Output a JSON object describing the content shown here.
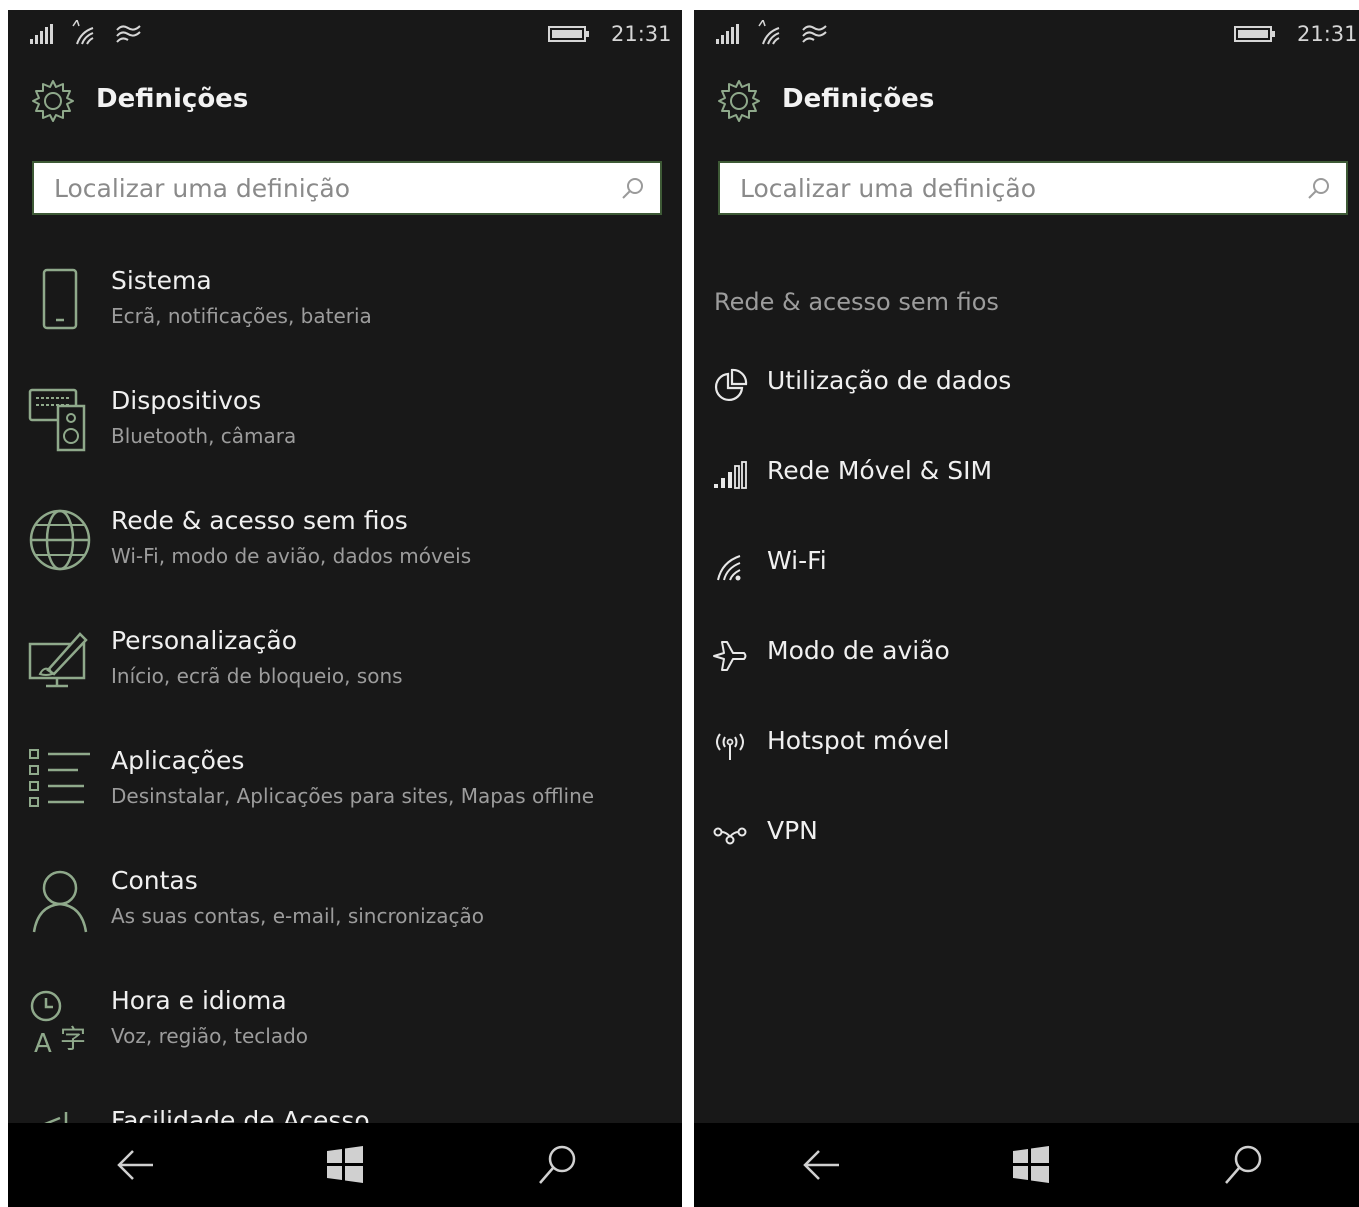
{
  "colors": {
    "background": "#181818",
    "accent": "#3e5a36",
    "icon_green": "#8fa98b",
    "text_primary": "#f0f0f0",
    "text_secondary": "#9c9c9c",
    "navbar": "#000000"
  },
  "status_bar": {
    "time": "21:31",
    "icons": [
      "signal-icon",
      "wifi-icon",
      "data-sense-icon",
      "battery-icon"
    ]
  },
  "left_screen": {
    "header": {
      "title": "Definições",
      "icon": "gear-icon"
    },
    "search": {
      "placeholder": "Localizar uma definição"
    },
    "categories": [
      {
        "title": "Sistema",
        "subtitle": "Ecrã, notificações, bateria",
        "icon": "phone-icon"
      },
      {
        "title": "Dispositivos",
        "subtitle": "Bluetooth, câmara",
        "icon": "devices-icon"
      },
      {
        "title": "Rede & acesso sem fios",
        "subtitle": "Wi-Fi, modo de avião, dados móveis",
        "icon": "globe-icon"
      },
      {
        "title": "Personalização",
        "subtitle": "Início, ecrã de bloqueio, sons",
        "icon": "paintbrush-icon"
      },
      {
        "title": "Aplicações",
        "subtitle": "Desinstalar, Aplicações para sites, Mapas offline",
        "icon": "apps-list-icon"
      },
      {
        "title": "Contas",
        "subtitle": "As suas contas, e-mail, sincronização",
        "icon": "person-icon"
      },
      {
        "title": "Hora e idioma",
        "subtitle": "Voz, região, teclado",
        "icon": "time-language-icon"
      },
      {
        "title": "Facilidade de Acesso",
        "subtitle": "",
        "icon": "ease-of-access-icon"
      }
    ]
  },
  "right_screen": {
    "header": {
      "title": "Definições",
      "icon": "gear-icon"
    },
    "search": {
      "placeholder": "Localizar uma definição"
    },
    "section_title": "Rede & acesso sem fios",
    "items": [
      {
        "label": "Utilização de dados",
        "icon": "data-usage-icon"
      },
      {
        "label": "Rede Móvel & SIM",
        "icon": "cellular-icon"
      },
      {
        "label": "Wi-Fi",
        "icon": "wifi-icon"
      },
      {
        "label": "Modo de avião",
        "icon": "airplane-icon"
      },
      {
        "label": "Hotspot móvel",
        "icon": "hotspot-icon"
      },
      {
        "label": "VPN",
        "icon": "vpn-icon"
      }
    ]
  },
  "nav_bar": {
    "buttons": [
      "back-icon",
      "windows-start-icon",
      "search-icon"
    ]
  }
}
